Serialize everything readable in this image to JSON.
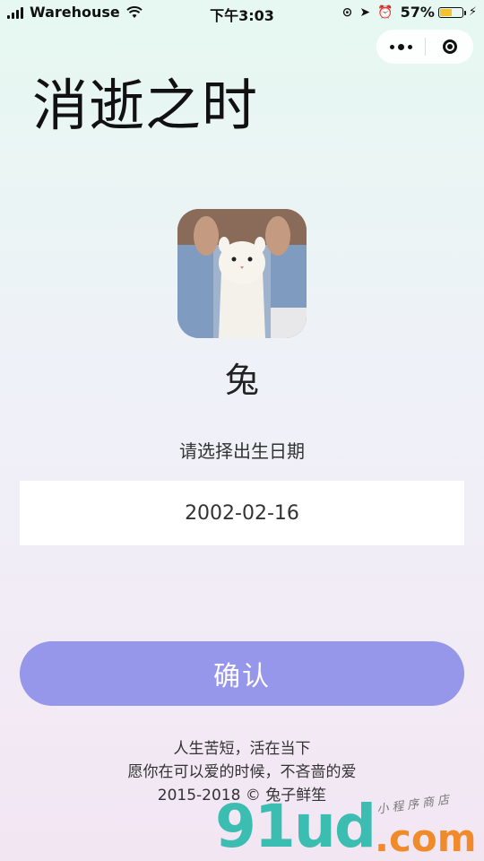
{
  "status_bar": {
    "carrier": "Warehouse",
    "time": "下午3:03",
    "battery_percent": "57%",
    "battery_level": 0.57,
    "icons": [
      "signal-icon",
      "wifi-icon",
      "screen-lock-icon",
      "location-icon",
      "alarm-icon",
      "battery-icon",
      "charging-icon"
    ]
  },
  "capsule": {
    "more_icon": "more-dots-icon",
    "close_icon": "target-close-icon"
  },
  "page": {
    "title": "消逝之时",
    "zodiac": "兔",
    "date_label": "请选择出生日期",
    "date_value": "2002-02-16",
    "confirm_label": "确认"
  },
  "footer": {
    "line1": "人生苦短，活在当下",
    "line2": "愿你在可以爱的时候，不吝啬的爱",
    "line3": "2015-2018 © 兔子鲜笙"
  },
  "watermark": {
    "main": "91ud",
    "domain": ".com",
    "sub": "小程序商店"
  },
  "colors": {
    "accent": "#9696ea",
    "bg_top": "#e6f8f1",
    "bg_bottom": "#f3e6f3",
    "battery": "#f2c230"
  }
}
